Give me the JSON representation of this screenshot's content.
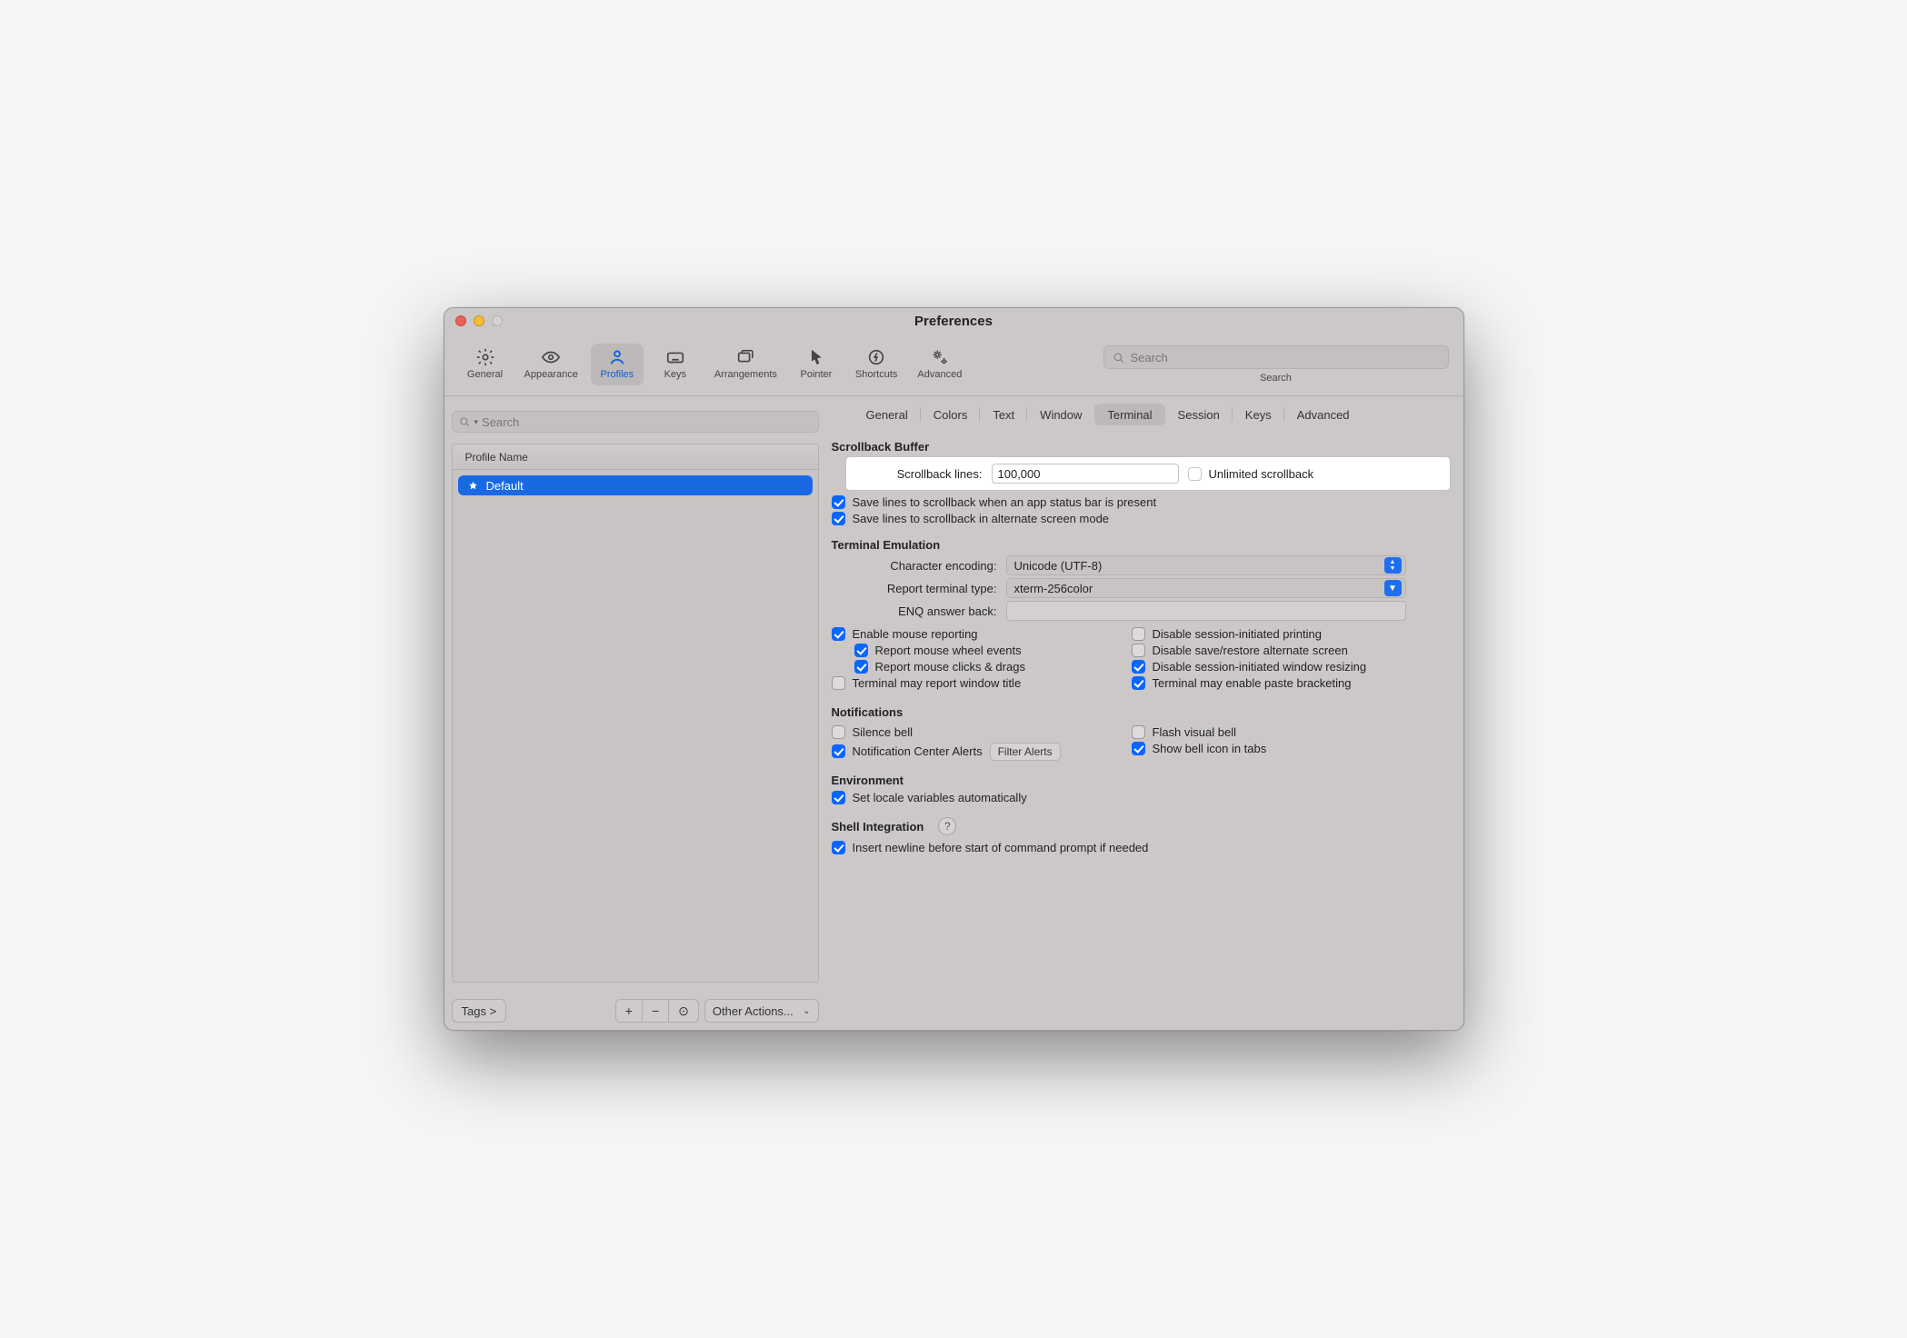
{
  "window": {
    "title": "Preferences"
  },
  "toolbar": {
    "items": {
      "general": "General",
      "appearance": "Appearance",
      "profiles": "Profiles",
      "keys": "Keys",
      "arrangements": "Arrangements",
      "pointer": "Pointer",
      "shortcuts": "Shortcuts",
      "advanced": "Advanced"
    },
    "search": {
      "placeholder": "Search",
      "label": "Search"
    }
  },
  "sidebar": {
    "search_placeholder": "Search",
    "column_header": "Profile Name",
    "profiles": [
      {
        "name": "Default"
      }
    ],
    "footer": {
      "tags": "Tags >",
      "add": "+",
      "remove": "−",
      "menu_glyph": "⊙",
      "other_actions": "Other Actions..."
    }
  },
  "tabs": [
    "General",
    "Colors",
    "Text",
    "Window",
    "Terminal",
    "Session",
    "Keys",
    "Advanced"
  ],
  "selected_tab": "Terminal",
  "sections": {
    "scrollback": {
      "title": "Scrollback Buffer",
      "lines_label": "Scrollback lines:",
      "lines_value": "100,000",
      "unlimited": "Unlimited scrollback",
      "save_status_bar": "Save lines to scrollback when an app status bar is present",
      "save_alt_screen": "Save lines to scrollback in alternate screen mode"
    },
    "emulation": {
      "title": "Terminal Emulation",
      "encoding_label": "Character encoding:",
      "encoding_value": "Unicode (UTF-8)",
      "termtype_label": "Report terminal type:",
      "termtype_value": "xterm-256color",
      "enq_label": "ENQ answer back:",
      "enq_value": "",
      "left": {
        "enable_mouse": "Enable mouse reporting",
        "wheel": "Report mouse wheel events",
        "clicks": "Report mouse clicks & drags",
        "report_title": "Terminal may report window title"
      },
      "right": {
        "disable_print": "Disable session-initiated printing",
        "disable_alt": "Disable save/restore alternate screen",
        "disable_resize": "Disable session-initiated window resizing",
        "paste_bracket": "Terminal may enable paste bracketing"
      }
    },
    "notifications": {
      "title": "Notifications",
      "silence": "Silence bell",
      "nc_alerts": "Notification Center Alerts",
      "filter_btn": "Filter Alerts",
      "flash": "Flash visual bell",
      "bell_icon": "Show bell icon in tabs"
    },
    "environment": {
      "title": "Environment",
      "locale": "Set locale variables automatically"
    },
    "shell": {
      "title": "Shell Integration",
      "insert_newline": "Insert newline before start of command prompt if needed"
    }
  }
}
